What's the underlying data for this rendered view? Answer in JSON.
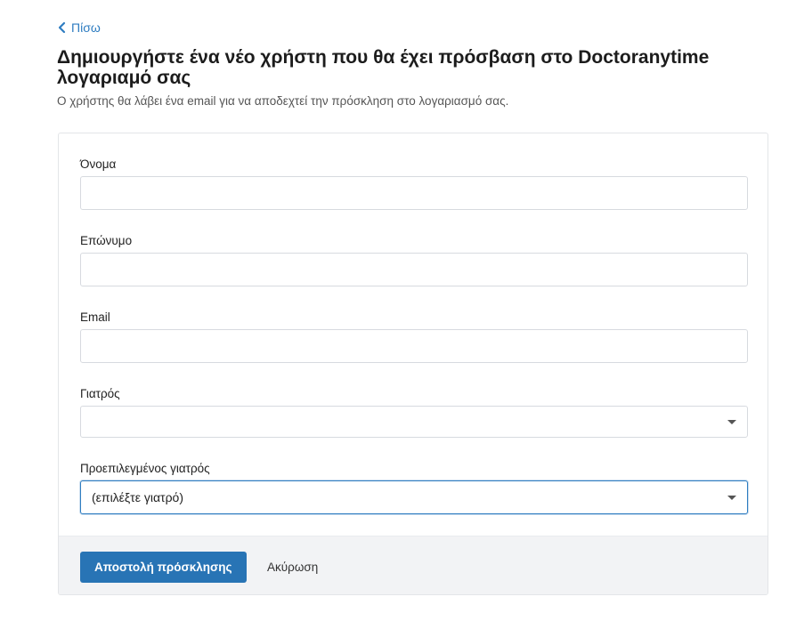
{
  "nav": {
    "back_label": "Πίσω"
  },
  "header": {
    "title": "Δημιουργήστε ένα νέο χρήστη που θα έχει πρόσβαση στο Doctoranytime λογαριαμό σας",
    "subtitle": "Ο χρήστης θα λάβει ένα email για να αποδεχτεί την πρόσκληση στο λογαριασμό σας."
  },
  "form": {
    "first_name": {
      "label": "Όνομα",
      "value": "",
      "placeholder": ""
    },
    "last_name": {
      "label": "Επώνυμο",
      "value": "",
      "placeholder": ""
    },
    "email": {
      "label": "Email",
      "value": "",
      "placeholder": ""
    },
    "doctor": {
      "label": "Γιατρός",
      "selected": ""
    },
    "default_doctor": {
      "label": "Προεπιλεγμένος γιατρός",
      "selected": "(επιλέξτε γιατρό)"
    }
  },
  "footer": {
    "submit_label": "Αποστολή πρόσκλησης",
    "cancel_label": "Ακύρωση"
  },
  "colors": {
    "accent": "#2874b5",
    "link": "#2f7dc1",
    "footer_bg": "#f2f3f5"
  },
  "icons": {
    "back": "chevron-left-icon",
    "dropdown": "caret-down-icon"
  }
}
